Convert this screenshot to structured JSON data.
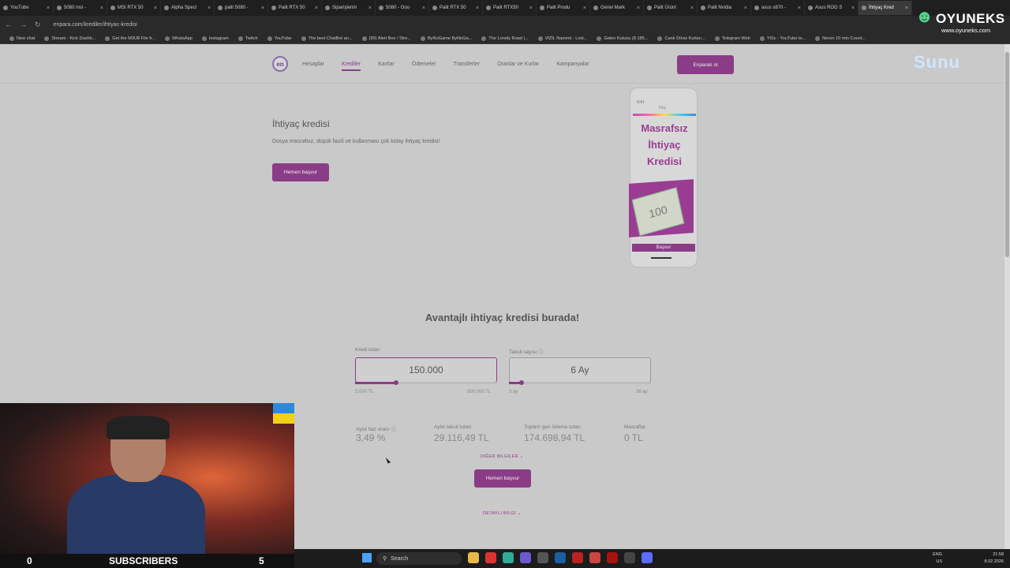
{
  "browser": {
    "tabs": [
      "YouTube",
      "5080 msi -",
      "MSI RTX 50",
      "Alpha Speci",
      "palit 5080 -",
      "Palit RTX 50",
      "Siparişlerim",
      "5080 - Goo",
      "Palit RTX 50",
      "Palit RTX50",
      "Palit Produ",
      "Genel Mark",
      "Palit Ürünl",
      "Palit Nvidia",
      "asus x870 -",
      "Asus ROG S",
      "İhtiyaç Kred"
    ],
    "url": "enpara.com/krediler/ihtiyac-kredisi",
    "bookmarks": [
      "New chat",
      "Stream - Kick Dashb...",
      "Get the M3U8 File fr...",
      "WhatsApp",
      "Instagram",
      "Twitch",
      "YouTube",
      "The best ChatBot an...",
      "(90) Alert Box / Stre...",
      "ByNoGame ByNoGa...",
      "The Lonely Road |...",
      "VİZİL Nasvmt - Lost...",
      "Gelen Kutusu (8.185...",
      "Canlı Döviz Kurları...",
      "Telegram Web",
      "YtSc - YouTube to...",
      "Neron 10 min Count..."
    ]
  },
  "site": {
    "logo": "en",
    "nav": [
      "Hesaplar",
      "Krediler",
      "Kartlar",
      "Ödemeler",
      "Transferler",
      "Oranlar ve Kurlar",
      "Kampanyalar"
    ],
    "cta": "Enparalı ol"
  },
  "hero": {
    "title": "İhtiyaç kredisi",
    "desc": "Dosya masrafsız, düşük faizli ve kullanması çok kolay ihtiyaç kredisi!",
    "button": "Hemen başvur",
    "phone_time": "9:41",
    "phone_label": "İhtiy",
    "phone_title": "Masrafsız İhtiyaç Kredisi",
    "phone_money": "100",
    "phone_button": "Başvur"
  },
  "calc": {
    "title": "Avantajlı ihtiyaç kredisi burada!",
    "amount_label": "Kredi tutarı",
    "amount_value": "150.000",
    "amount_min": "5.000 TL",
    "amount_max": "500.000 TL",
    "amount_fraction": 0.29,
    "term_label": "Taksit sayısı",
    "term_value": "6 Ay",
    "term_min": "3 ay",
    "term_max": "36 ay",
    "term_fraction": 0.09,
    "rate_label": "Aylık faiz oranı",
    "rate_value": "3,49 %",
    "inst_label": "Aylık taksit tutarı",
    "inst_value": "29.116,49 TL",
    "total_label": "Toplam geri ödeme tutarı",
    "total_value": "174.698,94 TL",
    "fees_label": "Masraflar",
    "fees_value": "0 TL",
    "more": "DİĞER BİLGİLER",
    "button": "Hemen başvur",
    "detail": "DETAYLI BİLGİ"
  },
  "stream": {
    "left_count": "0",
    "subscribers_label": "SUBSCRIBERS",
    "right_count": "5",
    "brand_name": "OYUNEKS",
    "brand_site": "www.oyuneks.com",
    "overlay": "Sunu"
  },
  "taskbar": {
    "search": "Search",
    "lang": "ENG",
    "region": "US",
    "time": "21:58",
    "date": "8.02.2026"
  }
}
